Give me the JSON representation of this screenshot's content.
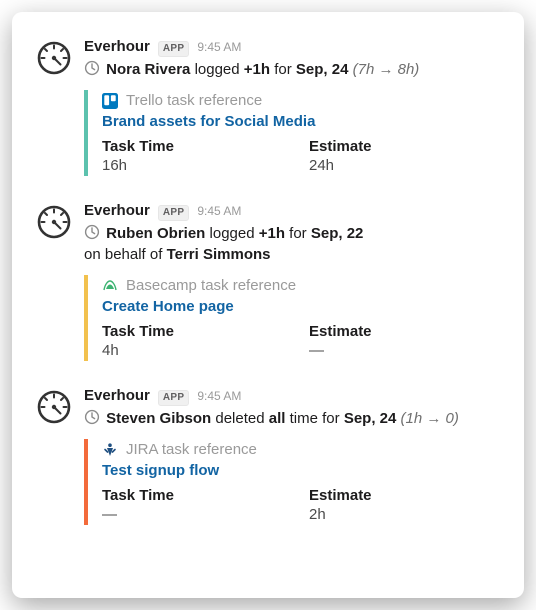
{
  "app": {
    "name": "Everhour",
    "badge": "APP"
  },
  "messages": [
    {
      "time": "9:45 AM",
      "actor": "Nora Rivera",
      "verb": "logged",
      "amount": "+1h",
      "preposition": "for",
      "date": "Sep, 24",
      "delta": "(7h → 8h)",
      "behalf_of": null,
      "attachment": {
        "accent": "green",
        "source_icon": "trello",
        "source_label": "Trello task reference",
        "task_title": "Brand assets for Social Media",
        "task_time_label": "Task Time",
        "task_time_value": "16h",
        "estimate_label": "Estimate",
        "estimate_value": "24h"
      }
    },
    {
      "time": "9:45 AM",
      "actor": "Ruben Obrien",
      "verb": "logged",
      "amount": "+1h",
      "preposition": "for",
      "date": "Sep, 22",
      "delta": null,
      "behalf_of": "Terri Simmons",
      "attachment": {
        "accent": "yellow",
        "source_icon": "basecamp",
        "source_label": "Basecamp task reference",
        "task_title": "Create Home page",
        "task_time_label": "Task Time",
        "task_time_value": "4h",
        "estimate_label": "Estimate",
        "estimate_value": "—"
      }
    },
    {
      "time": "9:45 AM",
      "actor": "Steven Gibson",
      "verb": "deleted",
      "amount": "all",
      "preposition": "time for",
      "date": "Sep, 24",
      "delta": "(1h → 0)",
      "behalf_of": null,
      "attachment": {
        "accent": "orange",
        "source_icon": "jira",
        "source_label": "JIRA task reference",
        "task_title": "Test signup flow",
        "task_time_label": "Task Time",
        "task_time_value": "—",
        "estimate_label": "Estimate",
        "estimate_value": "2h"
      }
    }
  ]
}
